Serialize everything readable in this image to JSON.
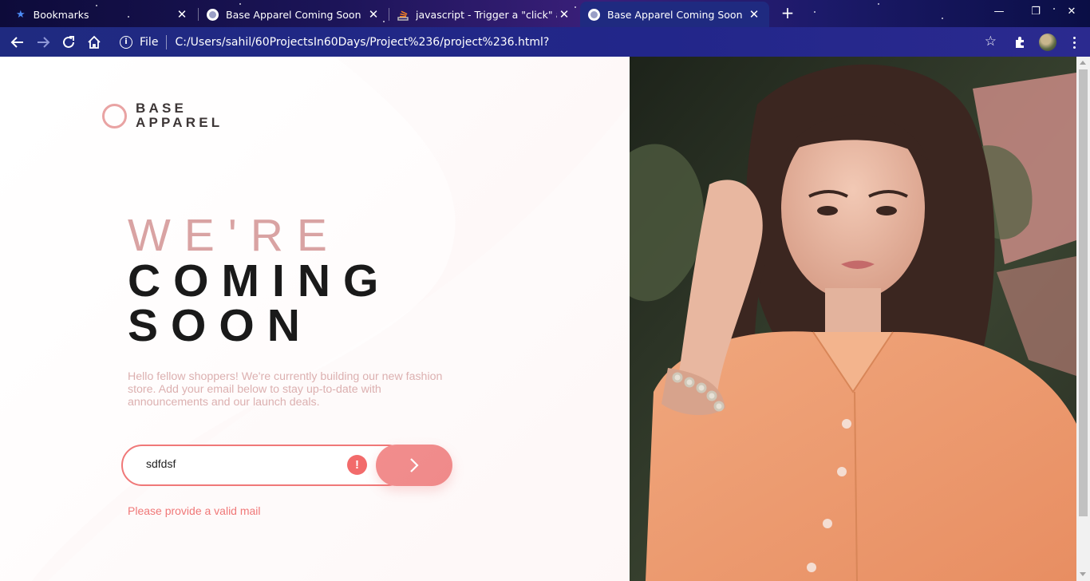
{
  "browser": {
    "tabs": [
      {
        "title": "Bookmarks",
        "icon": "star-icon"
      },
      {
        "title": "Base Apparel Coming Soon",
        "icon": "globe-icon"
      },
      {
        "title": "javascript - Trigger a \"click\" action",
        "icon": "stackoverflow-icon"
      },
      {
        "title": "Base Apparel Coming Soon",
        "icon": "globe-icon",
        "active": true
      }
    ],
    "new_tab": "+",
    "address": {
      "scheme_label": "File",
      "url": "C:/Users/sahil/60ProjectsIn60Days/Project%236/project%236.html?"
    },
    "window_controls": {
      "minimize": "—",
      "restore": "❐",
      "close": "✕"
    }
  },
  "page": {
    "logo": {
      "line1": "BASE",
      "line2": "APPAREL"
    },
    "headline": {
      "light": "WE'RE",
      "bold1": "COMING",
      "bold2": "SOON"
    },
    "description": "Hello fellow shoppers! We're currently building our new fashion store. Add your email below to stay up-to-date with announcements and our launch deals.",
    "form": {
      "email_value": "sdfdsf",
      "error_icon": "!",
      "submit_icon": "chevron-right-icon"
    },
    "error_message": "Please provide a valid mail"
  },
  "colors": {
    "accent": "#f07878",
    "headline_light": "#d9a3a3",
    "text_dark": "#1a1a1a",
    "chrome": "#1f2a80"
  }
}
